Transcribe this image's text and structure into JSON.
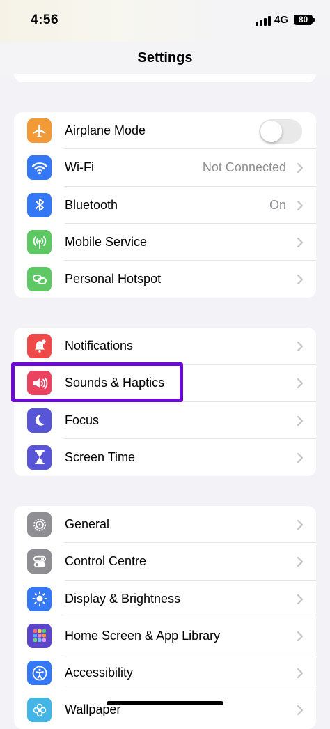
{
  "status_bar": {
    "time": "4:56",
    "network": "4G",
    "battery": "80"
  },
  "nav": {
    "title": "Settings"
  },
  "colors": {
    "accent_highlight": "#6c0ad6",
    "chevron": "#c4c4c7",
    "secondary_text": "#8e8e93"
  },
  "groups": [
    {
      "items": [
        {
          "label": "Airplane Mode",
          "icon": "airplane-icon",
          "icon_color": "#f19a37",
          "toggle": false
        },
        {
          "label": "Wi-Fi",
          "icon": "wifi-icon",
          "icon_color": "#3478f6",
          "value": "Not Connected"
        },
        {
          "label": "Bluetooth",
          "icon": "bluetooth-icon",
          "icon_color": "#3478f6",
          "value": "On"
        },
        {
          "label": "Mobile Service",
          "icon": "antenna-icon",
          "icon_color": "#5ec865"
        },
        {
          "label": "Personal Hotspot",
          "icon": "hotspot-link-icon",
          "icon_color": "#5ec865"
        }
      ]
    },
    {
      "items": [
        {
          "label": "Notifications",
          "icon": "bell-icon",
          "icon_color": "#ee4a4a"
        },
        {
          "label": "Sounds & Haptics",
          "icon": "speaker-icon",
          "icon_color": "#ea4360",
          "highlighted": true
        },
        {
          "label": "Focus",
          "icon": "moon-icon",
          "icon_color": "#5856d6"
        },
        {
          "label": "Screen Time",
          "icon": "hourglass-icon",
          "icon_color": "#5856d6"
        }
      ]
    },
    {
      "items": [
        {
          "label": "General",
          "icon": "gear-icon",
          "icon_color": "#8e8e93"
        },
        {
          "label": "Control Centre",
          "icon": "switches-icon",
          "icon_color": "#8e8e93"
        },
        {
          "label": "Display & Brightness",
          "icon": "sun-icon",
          "icon_color": "#3478f6"
        },
        {
          "label": "Home Screen & App Library",
          "icon": "app-grid-icon",
          "icon_color": "#5b46c9"
        },
        {
          "label": "Accessibility",
          "icon": "accessibility-icon",
          "icon_color": "#3478f6"
        },
        {
          "label": "Wallpaper",
          "icon": "flower-icon",
          "icon_color": "#43b6e6"
        }
      ]
    }
  ]
}
